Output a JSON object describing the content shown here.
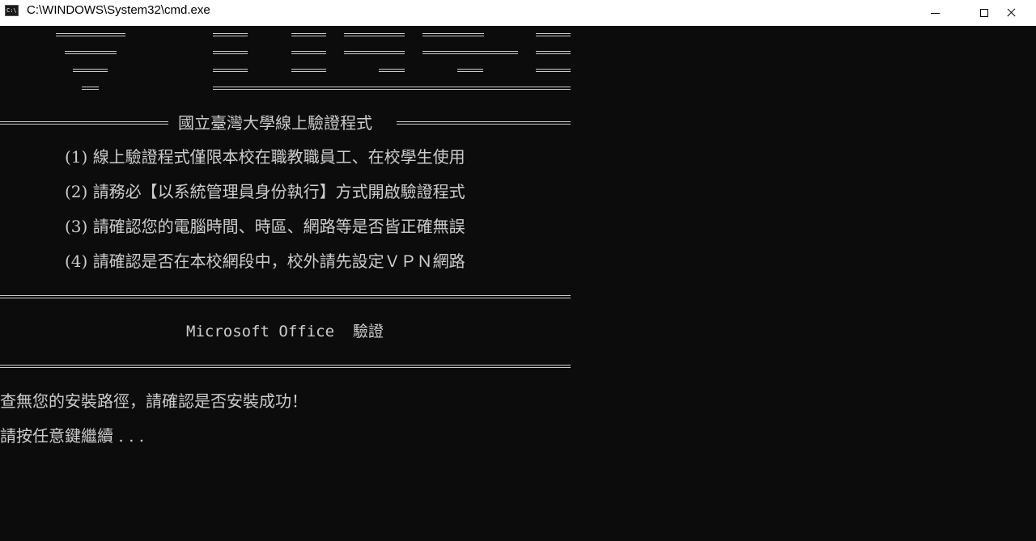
{
  "window": {
    "title": "C:\\WINDOWS\\System32\\cmd.exe",
    "icon": "cmd-icon",
    "icon_text": "C:\\."
  },
  "console": {
    "banner_title": "國立臺灣大學線上驗證程式",
    "notices": [
      "(1) 線上驗證程式僅限本校在職教職員工、在校學生使用",
      "(2) 請務必【以系統管理員身份執行】方式開啟驗證程式",
      "(3) 請確認您的電腦時間、時區、網路等是否皆正確無誤",
      "(4) 請確認是否在本校網段中，校外請先設定ＶＰＮ網路"
    ],
    "section_title": "Microsoft Office  驗證",
    "error_message": "查無您的安裝路徑，請確認是否安裝成功！",
    "prompt": "請按任意鍵繼續 . . ."
  },
  "colors": {
    "console_background": "#0c0c0c",
    "console_text": "#cccccc",
    "titlebar_background": "#ffffff"
  }
}
